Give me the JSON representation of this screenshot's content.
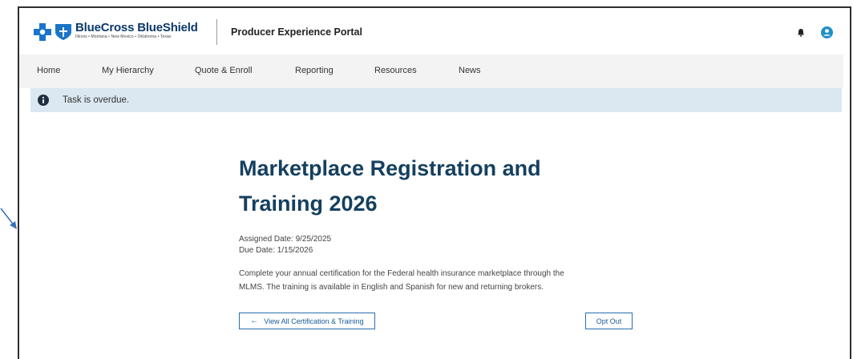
{
  "header": {
    "brand_name": "BlueCross BlueShield",
    "brand_states": "Illinois • Montana • New Mexico • Oklahoma • Texas",
    "portal_title": "Producer Experience Portal",
    "icons": [
      "bcbs-cross-icon",
      "bcbs-shield-icon",
      "bell-icon",
      "user-icon"
    ]
  },
  "nav": {
    "items": [
      {
        "label": "Home"
      },
      {
        "label": "My Hierarchy"
      },
      {
        "label": "Quote & Enroll"
      },
      {
        "label": "Reporting"
      },
      {
        "label": "Resources"
      },
      {
        "label": "News"
      }
    ]
  },
  "alert": {
    "icon": "info-icon",
    "text": "Task is overdue."
  },
  "task": {
    "title_line1": "Marketplace Registration and",
    "title_line2": "Training 2026",
    "assigned_date": "Assigned Date: 9/25/2025",
    "due_date": "Due Date: 1/15/2026",
    "description_line1": "Complete your annual certification for the Federal health insurance marketplace through the",
    "description_line2": "MLMS. The training is available in English and Spanish for new and returning brokers.",
    "view_all_label": "View All Certification & Training",
    "opt_out_label": "Opt Out"
  },
  "colors": {
    "brand_blue": "#0c3a6b",
    "title_blue": "#15405f",
    "alert_bg": "#dbe8f1",
    "nav_bg": "#f3f3f3",
    "accent": "#1f8fc7"
  }
}
